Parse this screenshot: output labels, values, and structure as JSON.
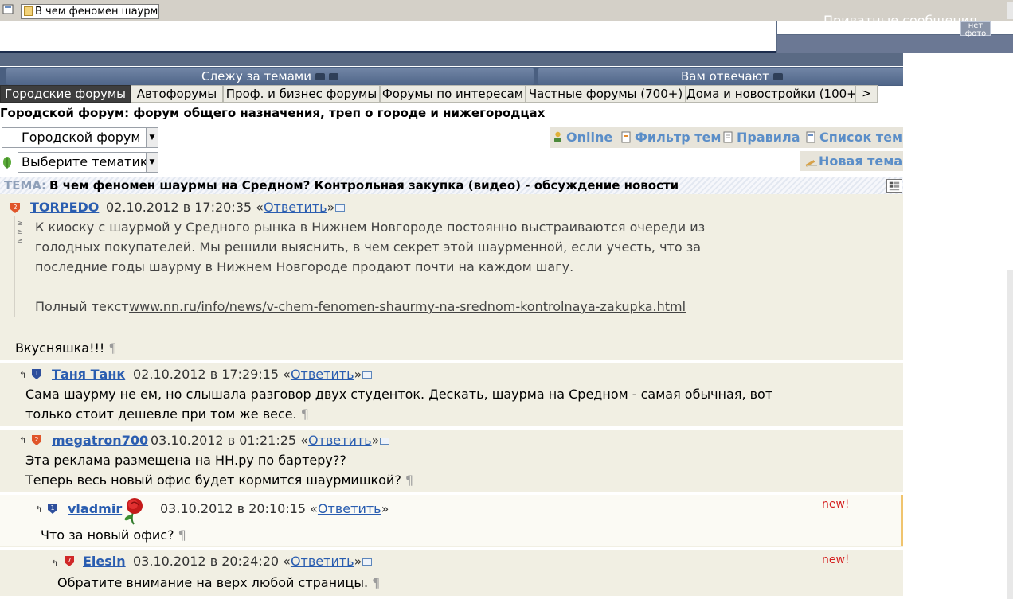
{
  "window": {
    "tab_title": "В чем феномен шаурмы ..."
  },
  "header": {
    "private_messages": "Приватные сообщения",
    "avatar_text": "нет фото"
  },
  "nav": {
    "tracking": "Слежу за темами",
    "replies": "Вам отвечают",
    "collapse": "<<"
  },
  "forum_tabs": [
    {
      "label": "Городские форумы"
    },
    {
      "label": "Автофорумы"
    },
    {
      "label": "Проф. и бизнес форумы"
    },
    {
      "label": "Форумы по интересам"
    },
    {
      "label": "Частные форумы (700+)"
    },
    {
      "label": "Дома и новостройки (100+"
    }
  ],
  "tab_next": ">",
  "forum": {
    "title": "Городской форум: форум общего назначения, треп о городе и нижегородцах",
    "select_forum": "Городской форум",
    "select_theme": "Выберите тематику"
  },
  "tools": {
    "online": "Online",
    "filter": "Фильтр тем",
    "rules": "Правила",
    "topics": "Список тем",
    "new_topic": "Новая тема"
  },
  "topic": {
    "label": "ТЕМА:",
    "title": "В чем феномен шаурмы на Средном? Контрольная закупка (видео) - обсуждение новости"
  },
  "reply_link": "Ответить",
  "new_label": "new!",
  "pilcrow": "¶",
  "posts": [
    {
      "user": "TORPEDO",
      "rank": "2",
      "date": "02.10.2012 в 17:20:35",
      "quote_lines": [
        "К киоску с шаурмой у Средного рынка в Нижнем Новгороде постоянно выстраиваются очереди из",
        "голодных покупателей. Мы решили выяснить, в чем секрет этой шаурменной, если учесть, что за",
        "последние годы шаурму в Нижнем Новгороде продают почти на каждом шагу."
      ],
      "quote_full_label": "Полный текст",
      "quote_url": "www.nn.ru/info/news/v-chem-fenomen-shaurmy-na-srednom-kontrolnaya-zakupka.html",
      "text": "Вкусняшка!!!"
    },
    {
      "user": "Таня Танк",
      "rank": "1",
      "date": "02.10.2012 в 17:29:15",
      "lines": [
        "Сама шаурму не ем, но слышала разговор двух студенток. Дескать, шаурма на Средном - самая обычная, вот",
        "только стоит дешевле при том же весе."
      ]
    },
    {
      "user": "megatron700",
      "rank": "2",
      "date": "03.10.2012 в 01:21:25",
      "lines": [
        "Эта реклама размещена на НН.ру по бартеру??",
        "Теперь весь новый офис будет кормится шаурмишкой?"
      ]
    },
    {
      "user": "vladmir",
      "rank": "1",
      "date": "03.10.2012 в 20:10:15",
      "text": "Что за новый офис?",
      "is_new": true
    },
    {
      "user": "Elesin",
      "rank": "7",
      "date": "03.10.2012 в 20:24:20",
      "text": "Обратите внимание на верх любой страницы.",
      "is_new": true
    }
  ],
  "colors": {
    "content_bg": "#f1efe3",
    "link": "#2a5db0",
    "tool_link": "#5b8ec8",
    "nav_bar": "#4a5f80",
    "new_badge": "#d42020"
  }
}
